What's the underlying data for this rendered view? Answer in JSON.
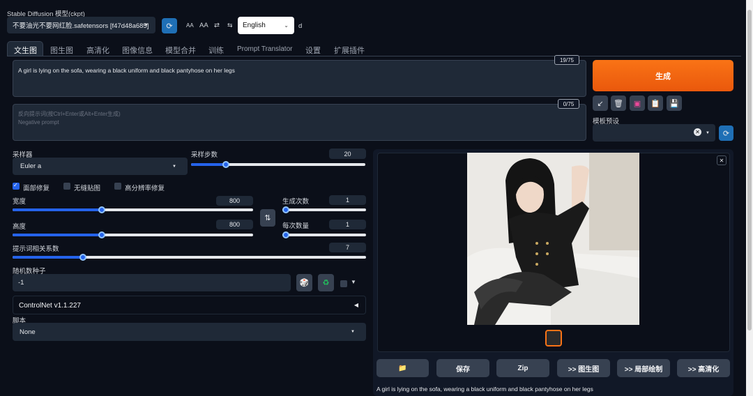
{
  "header": {
    "model_label": "Stable Diffusion 模型(ckpt)",
    "model_value": "不要油光不要网红脸.safetensors [f47d48a685]",
    "font_small": "AA",
    "font_large": "AA",
    "language": "English",
    "extra_char": "d"
  },
  "tabs": [
    "文生图",
    "图生图",
    "高清化",
    "图像信息",
    "模型合并",
    "训练",
    "Prompt Translator",
    "设置",
    "扩展插件"
  ],
  "prompt": {
    "positive": "A girl is lying on the sofa, wearing a black uniform and black pantyhose on her legs",
    "positive_count": "19/75",
    "negative_placeholder_cn": "反向提示词(按Ctrl+Enter或Alt+Enter生成)",
    "negative_placeholder_en": "Negative prompt",
    "negative_count": "0/75"
  },
  "generate_label": "生成",
  "styles_label": "模板预设",
  "sampler": {
    "method_label": "采样器",
    "method_value": "Euler a",
    "steps_label": "采样步数",
    "steps_value": "20",
    "steps_fraction": 0.2
  },
  "checks": {
    "face_restore": "面部修复",
    "tiling": "无缝贴图",
    "hires_fix": "高分辨率修复"
  },
  "size": {
    "width_label": "宽度",
    "width_value": "800",
    "width_fraction": 0.37,
    "height_label": "高度",
    "height_value": "800",
    "height_fraction": 0.37,
    "batch_count_label": "生成次数",
    "batch_count_value": "1",
    "batch_size_label": "每次数量",
    "batch_size_value": "1"
  },
  "cfg": {
    "label": "提示词相关系数",
    "value": "7",
    "fraction": 0.2
  },
  "seed": {
    "label": "随机数种子",
    "value": "-1"
  },
  "controlnet_label": "ControlNet v1.1.227",
  "script": {
    "label": "脚本",
    "value": "None"
  },
  "actions": {
    "save": "保存",
    "zip": "Zip",
    "to_img2img": ">> 图生图",
    "to_inpaint": ">> 局部绘制",
    "to_extras": ">> 高清化"
  },
  "output_caption": "A girl is lying on the sofa, wearing a black uniform and black pantyhose on her legs",
  "colors": {
    "accent_orange": "#f97316",
    "accent_blue": "#2563eb",
    "background": "#0b0f19"
  }
}
